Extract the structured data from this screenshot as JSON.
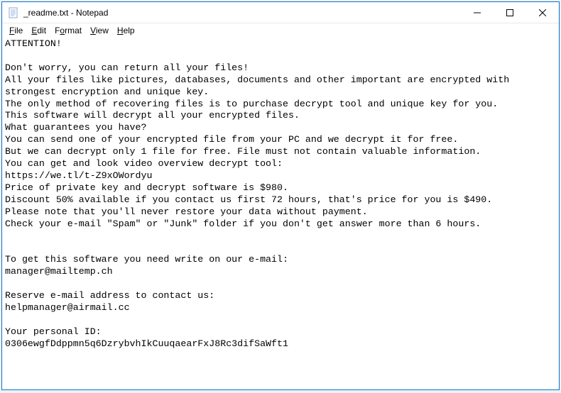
{
  "titlebar": {
    "title": "_readme.txt - Notepad"
  },
  "menu": {
    "file": "File",
    "edit": "Edit",
    "format": "Format",
    "view": "View",
    "help": "Help"
  },
  "content": {
    "text": "ATTENTION!\n\nDon't worry, you can return all your files!\nAll your files like pictures, databases, documents and other important are encrypted with strongest encryption and unique key.\nThe only method of recovering files is to purchase decrypt tool and unique key for you.\nThis software will decrypt all your encrypted files.\nWhat guarantees you have?\nYou can send one of your encrypted file from your PC and we decrypt it for free.\nBut we can decrypt only 1 file for free. File must not contain valuable information.\nYou can get and look video overview decrypt tool:\nhttps://we.tl/t-Z9xOWordyu\nPrice of private key and decrypt software is $980.\nDiscount 50% available if you contact us first 72 hours, that's price for you is $490.\nPlease note that you'll never restore your data without payment.\nCheck your e-mail \"Spam\" or \"Junk\" folder if you don't get answer more than 6 hours.\n\n\nTo get this software you need write on our e-mail:\nmanager@mailtemp.ch\n\nReserve e-mail address to contact us:\nhelpmanager@airmail.cc\n\nYour personal ID:\n0306ewgfDdppmn5q6DzrybvhIkCuuqaearFxJ8Rc3difSaWft1"
  }
}
